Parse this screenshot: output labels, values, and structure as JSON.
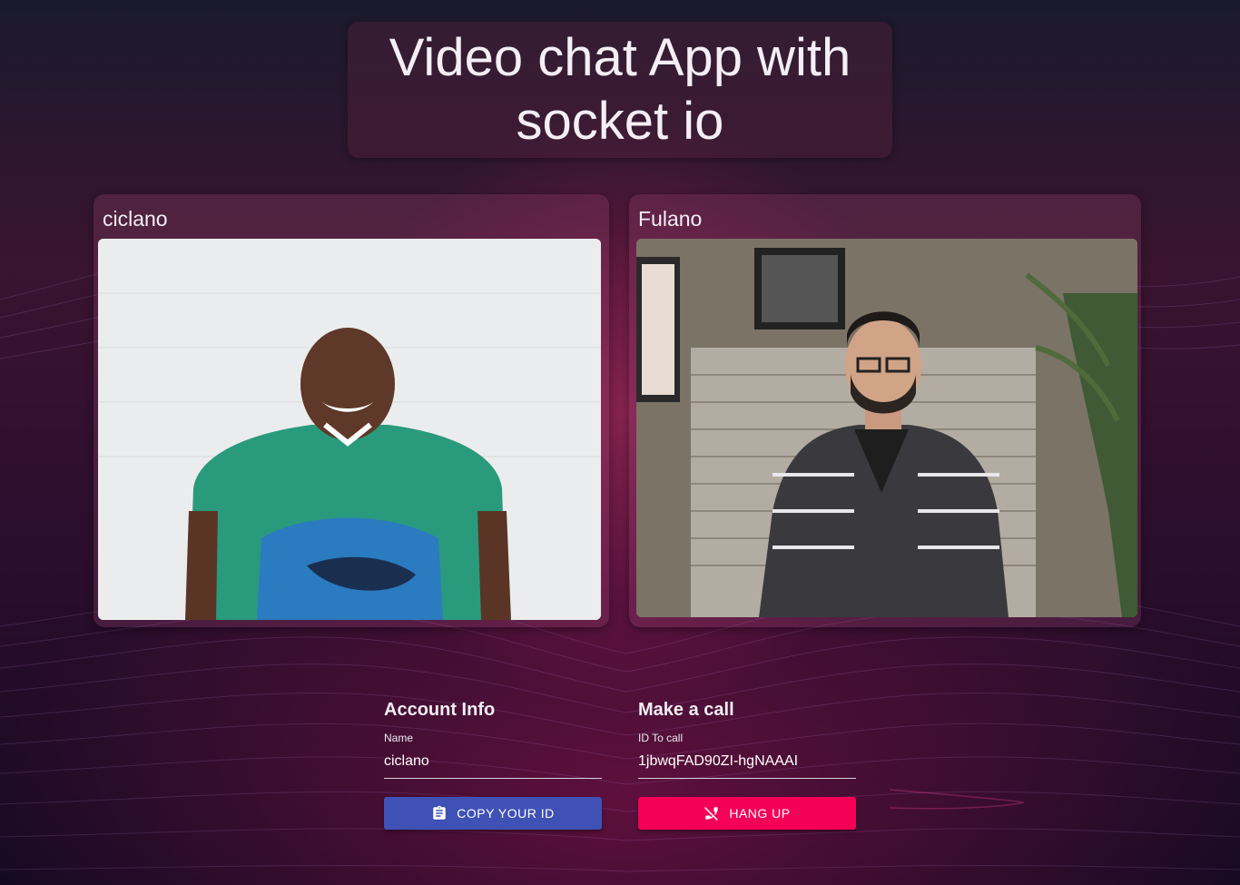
{
  "header": {
    "title": "Video chat App with socket io"
  },
  "videos": {
    "local": {
      "name": "ciclano"
    },
    "remote": {
      "name": "Fulano"
    }
  },
  "account": {
    "heading": "Account Info",
    "name_label": "Name",
    "name_value": "ciclano",
    "copy_button": "COPY YOUR ID",
    "copy_icon": "clipboard-icon"
  },
  "call": {
    "heading": "Make a call",
    "id_label": "ID To call",
    "id_value": "1jbwqFAD90ZI-hgNAAAI",
    "hangup_button": "HANG UP",
    "hangup_icon": "phone-disabled-icon"
  },
  "colors": {
    "primary": "#3f51b5",
    "secondary": "#f50057"
  }
}
